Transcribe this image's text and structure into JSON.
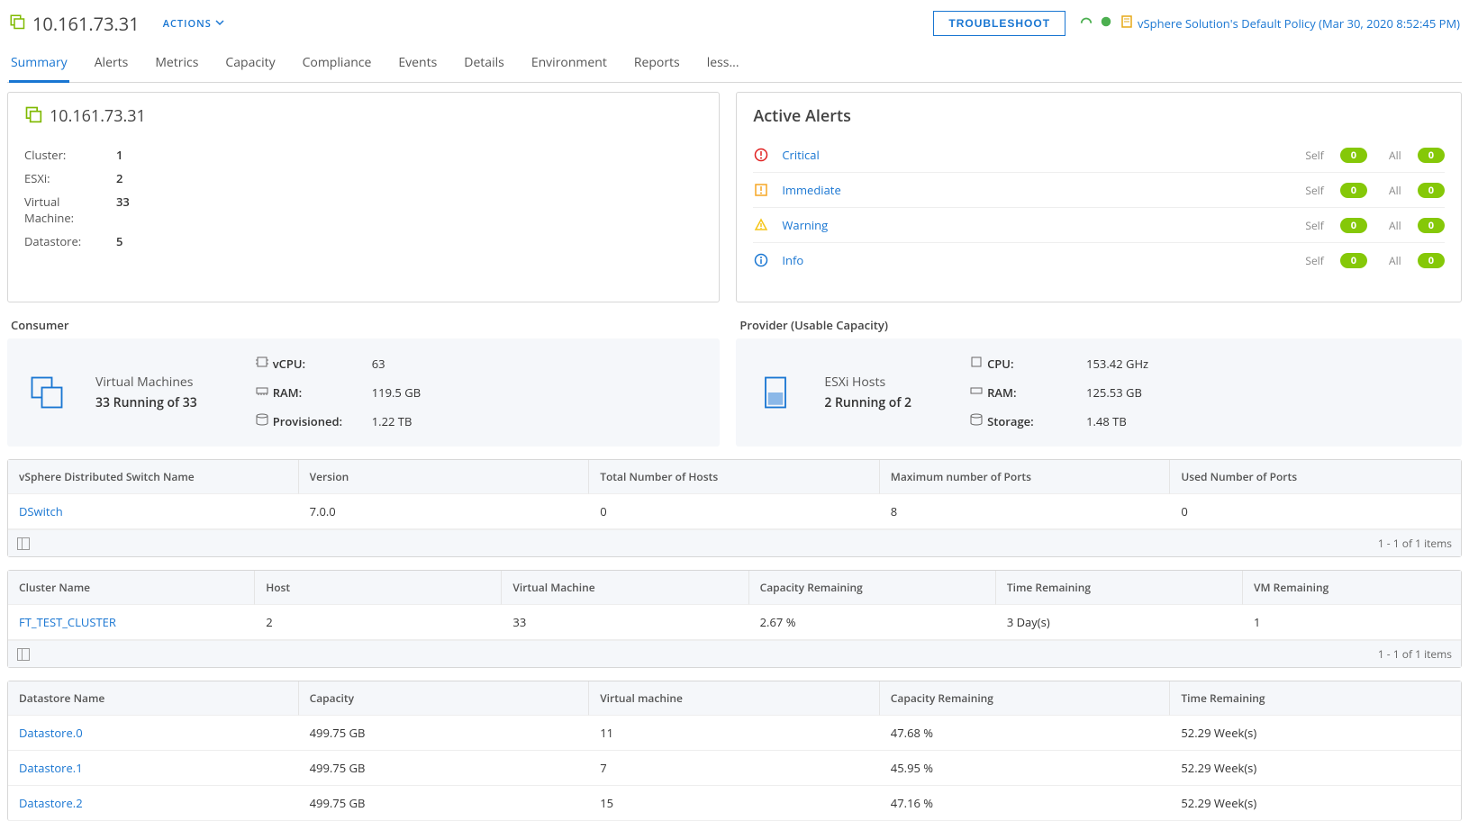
{
  "header": {
    "title": "10.161.73.31",
    "actions_label": "ACTIONS",
    "troubleshoot_label": "TROUBLESHOOT",
    "policy": "vSphere Solution's Default Policy (Mar 30, 2020 8:52:45 PM)"
  },
  "tabs": [
    "Summary",
    "Alerts",
    "Metrics",
    "Capacity",
    "Compliance",
    "Events",
    "Details",
    "Environment",
    "Reports",
    "less..."
  ],
  "active_tab_index": 0,
  "summary_card": {
    "title": "10.161.73.31",
    "rows": {
      "cluster_label": "Cluster:",
      "cluster_value": "1",
      "esxi_label": "ESXi:",
      "esxi_value": "2",
      "vm_label": "Virtual Machine:",
      "vm_value": "33",
      "ds_label": "Datastore:",
      "ds_value": "5"
    }
  },
  "alerts": {
    "title": "Active Alerts",
    "levels": [
      {
        "name": "Critical",
        "self": "0",
        "all": "0"
      },
      {
        "name": "Immediate",
        "self": "0",
        "all": "0"
      },
      {
        "name": "Warning",
        "self": "0",
        "all": "0"
      },
      {
        "name": "Info",
        "self": "0",
        "all": "0"
      }
    ],
    "self_label": "Self",
    "all_label": "All"
  },
  "consumer": {
    "label": "Consumer",
    "block_top": "Virtual Machines",
    "block_bot": "33 Running of 33",
    "metrics": {
      "vcpu_label": "vCPU:",
      "vcpu": "63",
      "ram_label": "RAM:",
      "ram": "119.5 GB",
      "prov_label": "Provisioned:",
      "prov": "1.22 TB"
    }
  },
  "provider": {
    "label": "Provider (Usable Capacity)",
    "block_top": "ESXi Hosts",
    "block_bot": "2 Running of 2",
    "metrics": {
      "cpu_label": "CPU:",
      "cpu": "153.42 GHz",
      "ram_label": "RAM:",
      "ram": "125.53 GB",
      "storage_label": "Storage:",
      "storage": "1.48 TB"
    }
  },
  "grid1": {
    "headers": [
      "vSphere Distributed Switch Name",
      "Version",
      "Total Number of Hosts",
      "Maximum number of Ports",
      "Used Number of Ports"
    ],
    "rows": [
      {
        "c1": "DSwitch",
        "c2": "7.0.0",
        "c3": "0",
        "c4": "8",
        "c5": "0"
      }
    ],
    "footer": "1 - 1 of 1 items"
  },
  "grid2": {
    "headers": [
      "Cluster Name",
      "Host",
      "Virtual Machine",
      "Capacity Remaining",
      "Time Remaining",
      "VM Remaining"
    ],
    "rows": [
      {
        "c1": "FT_TEST_CLUSTER",
        "c2": "2",
        "c3": "33",
        "c4": "2.67 %",
        "c5": "3 Day(s)",
        "c6": "1"
      }
    ],
    "footer": "1 - 1 of 1 items"
  },
  "grid3": {
    "headers": [
      "Datastore Name",
      "Capacity",
      "Virtual machine",
      "Capacity Remaining",
      "Time Remaining"
    ],
    "rows": [
      {
        "c1": "Datastore.0",
        "c2": "499.75 GB",
        "c3": "11",
        "c4": "47.68 %",
        "c5": "52.29 Week(s)"
      },
      {
        "c1": "Datastore.1",
        "c2": "499.75 GB",
        "c3": "7",
        "c4": "45.95 %",
        "c5": "52.29 Week(s)"
      },
      {
        "c1": "Datastore.2",
        "c2": "499.75 GB",
        "c3": "15",
        "c4": "47.16 %",
        "c5": "52.29 Week(s)"
      }
    ]
  }
}
